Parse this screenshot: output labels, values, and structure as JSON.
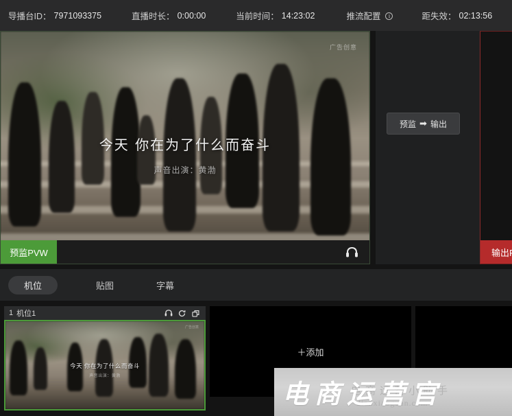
{
  "header": {
    "broadcast_id_label": "导播台ID：",
    "broadcast_id_value": "7971093375",
    "duration_label": "直播时长：",
    "duration_value": "0:00:00",
    "current_time_label": "当前时间：",
    "current_time_value": "14:23:02",
    "stream_config_label": "推流配置",
    "expiry_label": "距失效：",
    "expiry_value": "02:13:56"
  },
  "preview": {
    "badge": "预监PVW",
    "overlay_title": "今天 你在为了什么而奋斗",
    "overlay_subtitle": "声音出演：黄渤",
    "ad_tag": "广告创意"
  },
  "program": {
    "swap_left": "预监",
    "swap_arrow": "➡",
    "swap_right": "输出",
    "badge": "输出PG"
  },
  "tabs": [
    {
      "label": "机位",
      "active": true
    },
    {
      "label": "贴图",
      "active": false
    },
    {
      "label": "字幕",
      "active": false
    }
  ],
  "slots": [
    {
      "index": "1",
      "name": "机位1",
      "overlay_title": "今天 你在为了什么而奋斗",
      "overlay_subtitle": "声音出演：黄渤",
      "ad_tag": "广告创意"
    },
    {
      "add_label": "＋添加"
    },
    {
      "add_label": ""
    }
  ],
  "watermark": {
    "main": "电商运营官",
    "back": "电商运营小助手",
    "url": "dianxiaoguan.com"
  },
  "colors": {
    "preview_accent": "#4c9b39",
    "program_accent": "#b52b2b",
    "header_bg": "#2a2a2b",
    "panel_bg": "#232425",
    "page_bg": "#141414"
  }
}
